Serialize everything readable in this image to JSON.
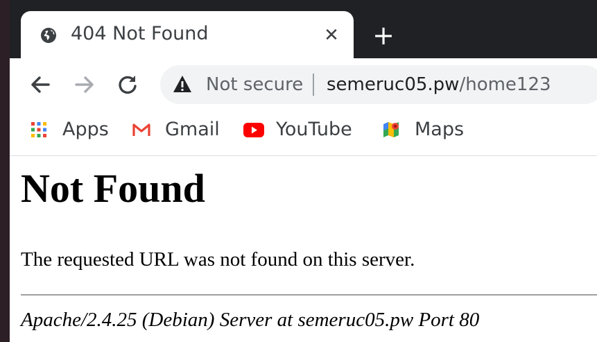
{
  "browser": {
    "tab": {
      "title": "404 Not Found",
      "favicon": "globe-icon",
      "close_glyph": "✕"
    },
    "new_tab_glyph": "+",
    "nav": {
      "back_icon": "back-arrow-icon",
      "forward_icon": "forward-arrow-icon",
      "reload_icon": "reload-icon"
    },
    "omnibox": {
      "security_label": "Not secure",
      "security_icon": "warning-triangle-icon",
      "url_host": "semeruc05.pw",
      "url_path": "/home123"
    },
    "bookmarks": [
      {
        "label": "Apps",
        "icon": "apps-grid-icon"
      },
      {
        "label": "Gmail",
        "icon": "gmail-icon"
      },
      {
        "label": "YouTube",
        "icon": "youtube-icon"
      },
      {
        "label": "Maps",
        "icon": "maps-icon"
      }
    ]
  },
  "page": {
    "heading": "Not Found",
    "message": "The requested URL was not found on this server.",
    "server_signature": "Apache/2.4.25 (Debian) Server at semeruc05.pw Port 80"
  },
  "colors": {
    "chrome_dark": "#202124",
    "omnibox_bg": "#f1f3f4",
    "text_secondary": "#5f6368",
    "gmail_red": "#ea4335",
    "youtube_red": "#ff0000"
  }
}
